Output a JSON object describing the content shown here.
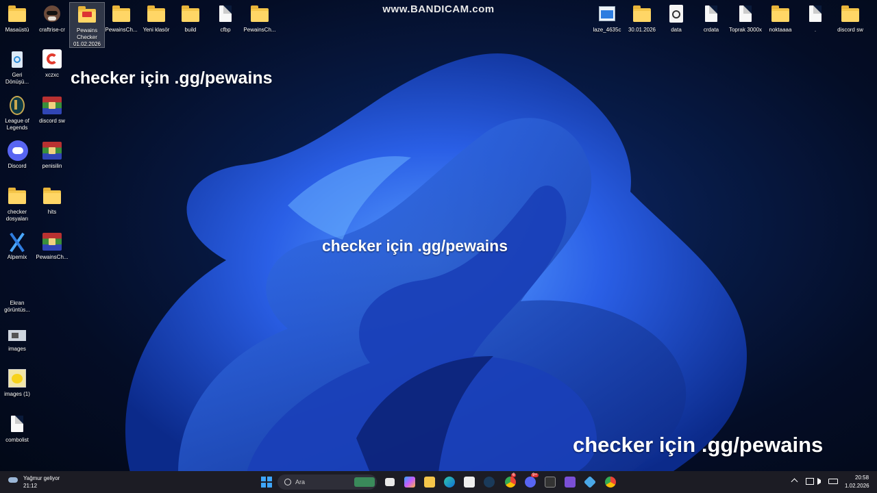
{
  "watermark": "www.BANDICAM.com",
  "overlays": [
    "checker için .gg/pewains",
    "checker için .gg/pewains",
    "checker için .gg/pewains"
  ],
  "desktop": {
    "top_left": [
      {
        "label": "Masaüstü",
        "icon": "desktop-folder-icon"
      },
      {
        "label": "craftrise-cr",
        "icon": "raccoon-icon"
      },
      {
        "label": "Pewains Checker 01.02.2026",
        "icon": "folder-icon"
      },
      {
        "label": "PewainsCh...",
        "icon": "folder-icon"
      },
      {
        "label": "Yeni klasör",
        "icon": "folder-icon"
      },
      {
        "label": "build",
        "icon": "folder-icon"
      },
      {
        "label": "cfbp",
        "icon": "file-icon"
      },
      {
        "label": "PewainsCh...",
        "icon": "folder-icon"
      }
    ],
    "left_column": [
      {
        "label": "Geri Dönüşü...",
        "icon": "recycle-bin-icon"
      },
      {
        "label": "League of Legends",
        "icon": "league-icon"
      },
      {
        "label": "Discord",
        "icon": "discord-icon"
      },
      {
        "label": "checker dosyaları",
        "icon": "folder-icon"
      },
      {
        "label": "Alpemix",
        "icon": "alpemix-icon"
      },
      {
        "label": "Ekran görüntüs...",
        "icon": "screenshot-icon"
      },
      {
        "label": "images",
        "icon": "image-icon"
      },
      {
        "label": "images (1)",
        "icon": "pikachu-image-icon"
      },
      {
        "label": "combolist",
        "icon": "file-icon"
      }
    ],
    "second_column": [
      {
        "label": "xczxc",
        "icon": "ccleaner-icon"
      },
      {
        "label": "discord sw",
        "icon": "winrar-icon"
      },
      {
        "label": "penisilin",
        "icon": "winrar-icon"
      },
      {
        "label": "hits",
        "icon": "folder-icon"
      },
      {
        "label": "PewainsCh...",
        "icon": "winrar-icon"
      }
    ],
    "top_right": [
      {
        "label": "laze_4635c",
        "icon": "image-file-icon"
      },
      {
        "label": "30.01.2026",
        "icon": "folder-icon"
      },
      {
        "label": "data",
        "icon": "data-file-icon"
      },
      {
        "label": "crdata",
        "icon": "file-icon"
      },
      {
        "label": "Toprak 3000x",
        "icon": "text-file-icon"
      },
      {
        "label": "noktaaaa",
        "icon": "folder-icon"
      },
      {
        "label": ".",
        "icon": "text-file-icon"
      },
      {
        "label": "discord sw",
        "icon": "folder-icon"
      }
    ]
  },
  "taskbar": {
    "weather": {
      "label": "Yağmur geliyor",
      "time": "21:12"
    },
    "search_placeholder": "Ara",
    "apps": [
      "start-icon",
      "search-icon",
      "widgets-icon",
      "task-view-icon",
      "copilot-icon",
      "file-explorer-icon",
      "edge-icon",
      "store-icon",
      "steam-icon",
      "chrome-icon",
      "discord-icon",
      "terminal-icon",
      "visual-studio-icon",
      "network-tool-icon",
      "chrome-icon"
    ],
    "badges": {
      "chrome": "6",
      "discord": "9+"
    },
    "clock": {
      "time": "20:58",
      "date": "1.02.2026"
    }
  }
}
